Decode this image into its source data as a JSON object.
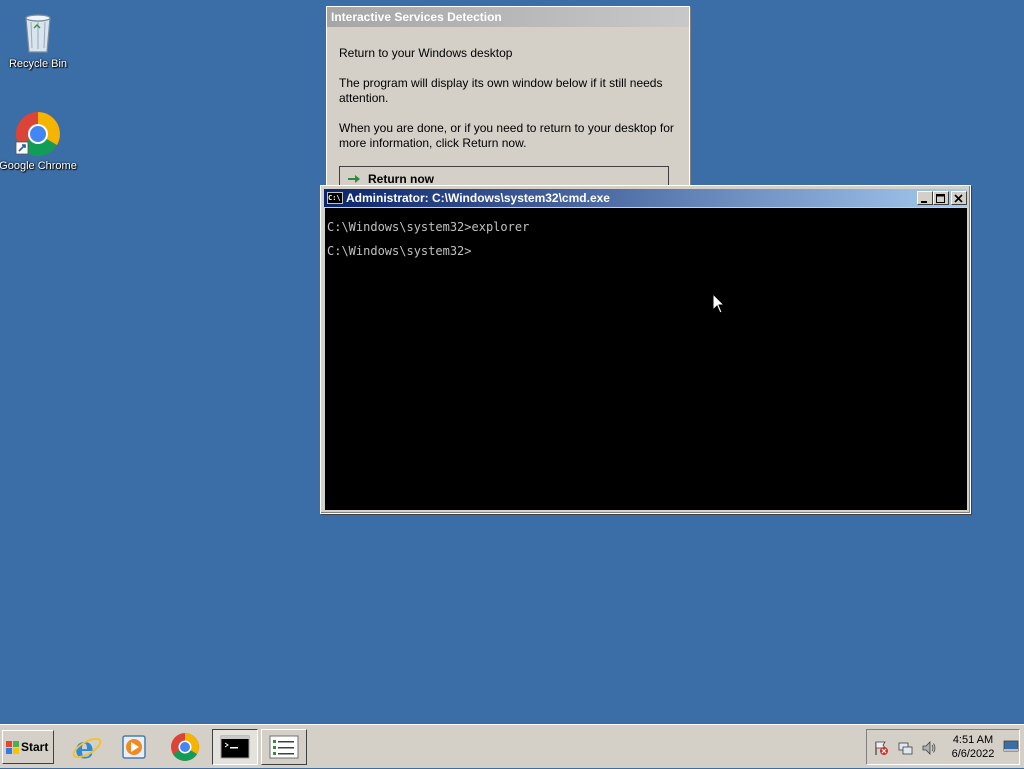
{
  "desktop": {
    "icons": [
      {
        "label": "Recycle Bin",
        "icon": "recycle-bin-icon"
      },
      {
        "label": "Google Chrome",
        "icon": "chrome-icon"
      }
    ]
  },
  "isd_dialog": {
    "title": "Interactive Services Detection",
    "heading": "Return to your Windows desktop",
    "para1": "The program will display its own window below if it still needs attention.",
    "para2": "When you are done, or if you need to return to your desktop for more information, click Return now.",
    "return_label": "Return now"
  },
  "cmd_window": {
    "title": "Administrator: C:\\Windows\\system32\\cmd.exe",
    "app_icon_text": "C:\\",
    "lines": [
      "C:\\Windows\\system32>explorer",
      "C:\\Windows\\system32>"
    ]
  },
  "taskbar": {
    "start_label": "Start",
    "quick_launch": [
      "internet-explorer-icon",
      "media-player-icon",
      "chrome-icon"
    ],
    "tasks": [
      {
        "name": "cmd-task",
        "icon": "console-icon",
        "active": true
      },
      {
        "name": "task-manager-task",
        "icon": "list-icon",
        "active": false
      }
    ],
    "tray": {
      "time": "4:51 AM",
      "date": "6/6/2022"
    }
  },
  "colors": {
    "desktop": "#3b6ea6",
    "titlebar_active_start": "#0a246a",
    "titlebar_active_end": "#a6caf0",
    "chrome": "#d4d0c8"
  }
}
